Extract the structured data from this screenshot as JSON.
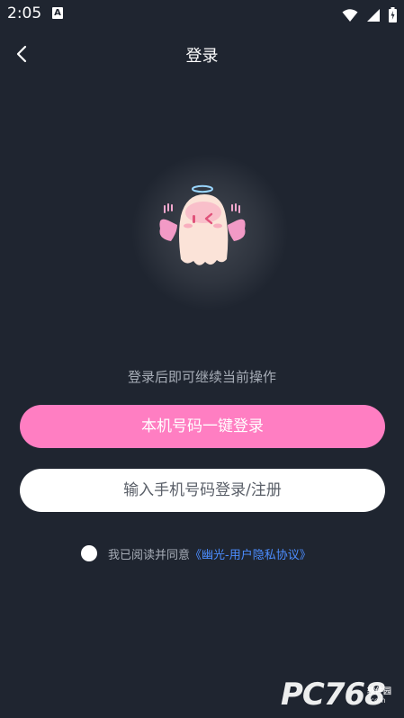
{
  "status_bar": {
    "time": "2:05",
    "app_icon_letter": "A",
    "icons": [
      "wifi-icon",
      "cellular-signal-icon",
      "battery-icon"
    ]
  },
  "nav": {
    "back_icon": "chevron-left-icon",
    "title": "登录"
  },
  "mascot": {
    "icon": "ghost-angel-mascot"
  },
  "hint": "登录后即可继续当前操作",
  "buttons": {
    "one_click": "本机号码一键登录",
    "phone_login": "输入手机号码登录/注册"
  },
  "agreement": {
    "checked": false,
    "prefix": "我已阅读并同意",
    "link": "《幽光-用户隐私协议》"
  },
  "watermark": {
    "main": "PC768",
    "sub1": "软件园",
    "sub2": ".com"
  },
  "colors": {
    "background": "#1f2530",
    "primary_button": "#ff7ec2",
    "secondary_button": "#ffffff",
    "link": "#4c8dff",
    "muted_text": "#a7adb7"
  }
}
